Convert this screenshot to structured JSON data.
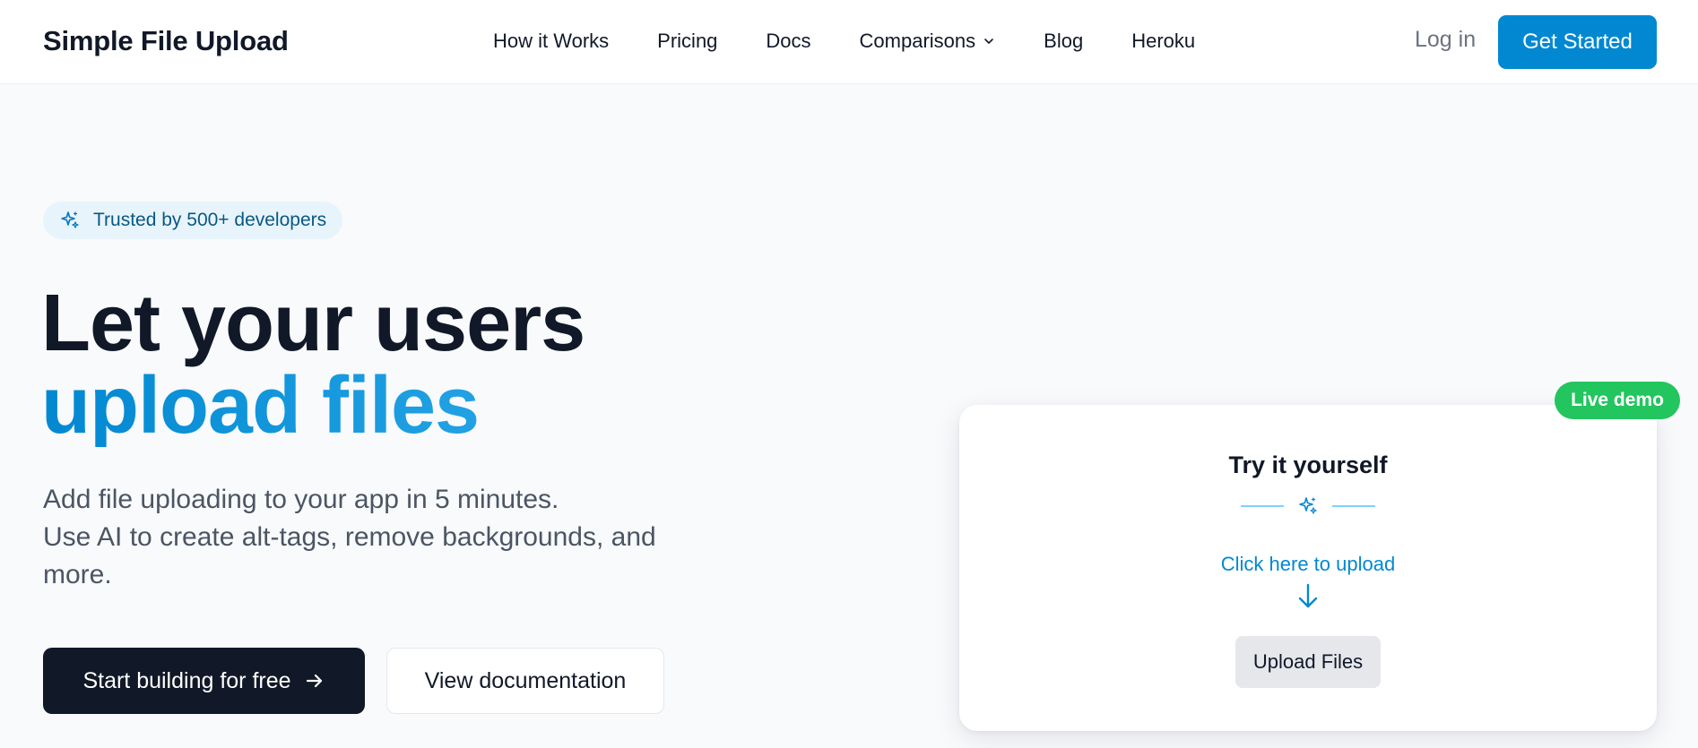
{
  "header": {
    "brand": "Simple File Upload",
    "nav": [
      {
        "label": "How it Works"
      },
      {
        "label": "Pricing"
      },
      {
        "label": "Docs"
      },
      {
        "label": "Comparisons",
        "has_dropdown": true
      },
      {
        "label": "Blog"
      },
      {
        "label": "Heroku"
      }
    ],
    "login_label": "Log in",
    "cta_label": "Get Started"
  },
  "hero": {
    "badge_icon": "sparkles-icon",
    "badge_text": "Trusted by 500+ developers",
    "headline_line1": "Let your users",
    "headline_line2": "upload files",
    "subtitle_line1": "Add file uploading to your app in 5 minutes.",
    "subtitle_line2": "Use AI to create alt-tags, remove backgrounds, and more.",
    "primary_cta": "Start building for free",
    "secondary_cta": "View documentation"
  },
  "demo": {
    "live_badge": "Live demo",
    "title": "Try it yourself",
    "hint": "Click here to upload",
    "button": "Upload Files"
  },
  "colors": {
    "brand_blue": "#0288d1",
    "accent_gradient_end": "#29a8e8",
    "dark": "#111827",
    "live_green": "#22c55e",
    "page_bg": "#f8fafc"
  }
}
